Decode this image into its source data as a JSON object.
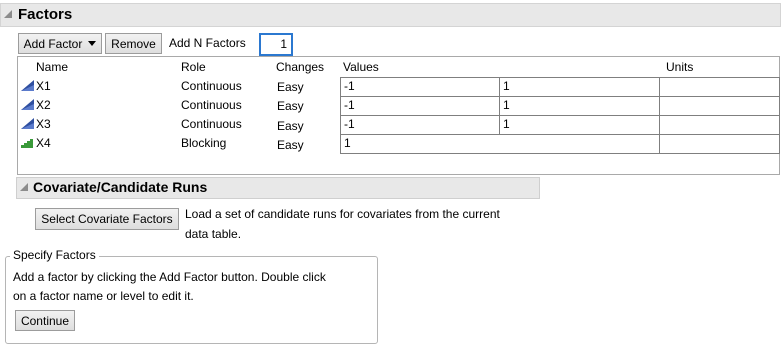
{
  "factors": {
    "title": "Factors",
    "add_factor_label": "Add Factor",
    "remove_label": "Remove",
    "add_n_label": "Add N Factors",
    "n_value": "1",
    "columns": {
      "name": "Name",
      "role": "Role",
      "changes": "Changes",
      "values": "Values",
      "units": "Units"
    },
    "rows": [
      {
        "name": "X1",
        "role": "Continuous",
        "changes": "Easy",
        "v1": "-1",
        "v2": "1",
        "units": "",
        "icon": "continuous-icon"
      },
      {
        "name": "X2",
        "role": "Continuous",
        "changes": "Easy",
        "v1": "-1",
        "v2": "1",
        "units": "",
        "icon": "continuous-icon"
      },
      {
        "name": "X3",
        "role": "Continuous",
        "changes": "Easy",
        "v1": "-1",
        "v2": "1",
        "units": "",
        "icon": "continuous-icon"
      },
      {
        "name": "X4",
        "role": "Blocking",
        "changes": "Easy",
        "v1": "1",
        "units": "",
        "icon": "blocking-icon"
      }
    ]
  },
  "covariate": {
    "title": "Covariate/Candidate Runs",
    "button_label": "Select Covariate Factors",
    "desc_line1": "Load a set of candidate runs for covariates from the current",
    "desc_line2": "data table."
  },
  "specify": {
    "title": "Specify Factors",
    "line1": "Add a factor by clicking the Add Factor button. Double click",
    "line2": "on a factor name or level to edit it.",
    "continue_label": "Continue"
  },
  "colors": {
    "accent": "#2b78d0",
    "continuous_icon": "#2f4fa0",
    "blocking_icon": "#3a9a3a"
  }
}
